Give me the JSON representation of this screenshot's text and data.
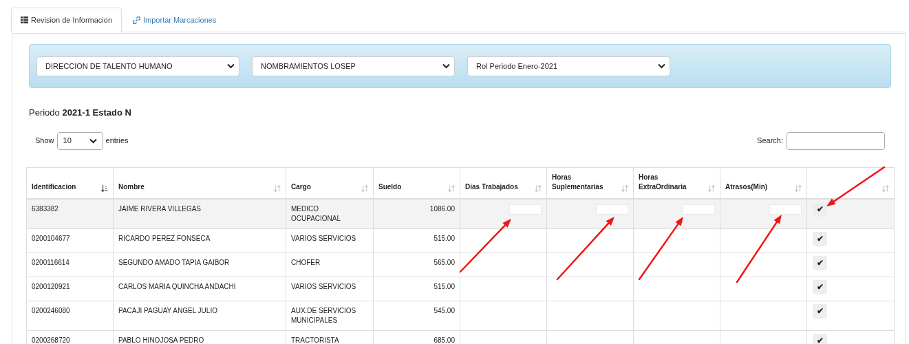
{
  "tabs": [
    {
      "label": "Revision de Informacion",
      "selected": true
    },
    {
      "label": "Importar Marcaciones",
      "selected": false
    }
  ],
  "filters": [
    "DIRECCION DE TALENTO HUMANO",
    "NOMBRAMIENTOS LOSEP",
    "Rol Periodo Enero-2021"
  ],
  "period": {
    "label": "Periodo",
    "value": "2021-1 Estado N"
  },
  "page_length": {
    "prefix": "Show",
    "value": "10",
    "suffix": "entries"
  },
  "search": {
    "label": "Search:"
  },
  "table": {
    "columns": [
      {
        "label": "Identificacion",
        "sorted": true,
        "kind": "text"
      },
      {
        "label": "Nombre",
        "sorted": false,
        "kind": "text"
      },
      {
        "label": "Cargo",
        "sorted": false,
        "kind": "text"
      },
      {
        "label": "Sueldo",
        "sorted": false,
        "kind": "number"
      },
      {
        "label": "Dias Trabajados",
        "sorted": false,
        "kind": "input"
      },
      {
        "label": "Horas Suplementarias",
        "sorted": false,
        "kind": "input"
      },
      {
        "label": "Horas ExtraOrdinaria",
        "sorted": false,
        "kind": "input"
      },
      {
        "label": "Atrasos(Min)",
        "sorted": false,
        "kind": "input"
      },
      {
        "sorted": false,
        "kind": "action"
      }
    ],
    "rows": [
      {
        "cells": [
          "6383382",
          "JAIME RIVERA VILLEGAS",
          "MEDICO OCUPACIONAL",
          "1086.00"
        ],
        "highlighted": true,
        "editable": true,
        "action": "✔"
      },
      {
        "cells": [
          "0200104677",
          "RICARDO PEREZ FONSECA",
          "VARIOS SERVICIOS",
          "515.00"
        ],
        "highlighted": false,
        "editable": false,
        "action": "✔"
      },
      {
        "cells": [
          "0200116614",
          "SEGUNDO AMADO TAPIA GAIBOR",
          "CHOFER",
          "565.00"
        ],
        "highlighted": false,
        "editable": false,
        "action": "✔"
      },
      {
        "cells": [
          "0200120921",
          "CARLOS MARIA QUINCHA ANDACHI",
          "VARIOS SERVICIOS",
          "515.00"
        ],
        "highlighted": false,
        "editable": false,
        "action": "✔"
      },
      {
        "cells": [
          "0200246080",
          "PACAJI PAGUAY ANGEL JULIO",
          "AUX.DE SERVICIOS MUNICIPALES",
          "545.00"
        ],
        "highlighted": false,
        "editable": false,
        "action": "✔"
      },
      {
        "cells": [
          "0200268720",
          "PABLO HINOJOSA PEDRO",
          "TRACTORISTA",
          "685.00"
        ],
        "highlighted": false,
        "editable": false,
        "action": "✔"
      }
    ]
  }
}
